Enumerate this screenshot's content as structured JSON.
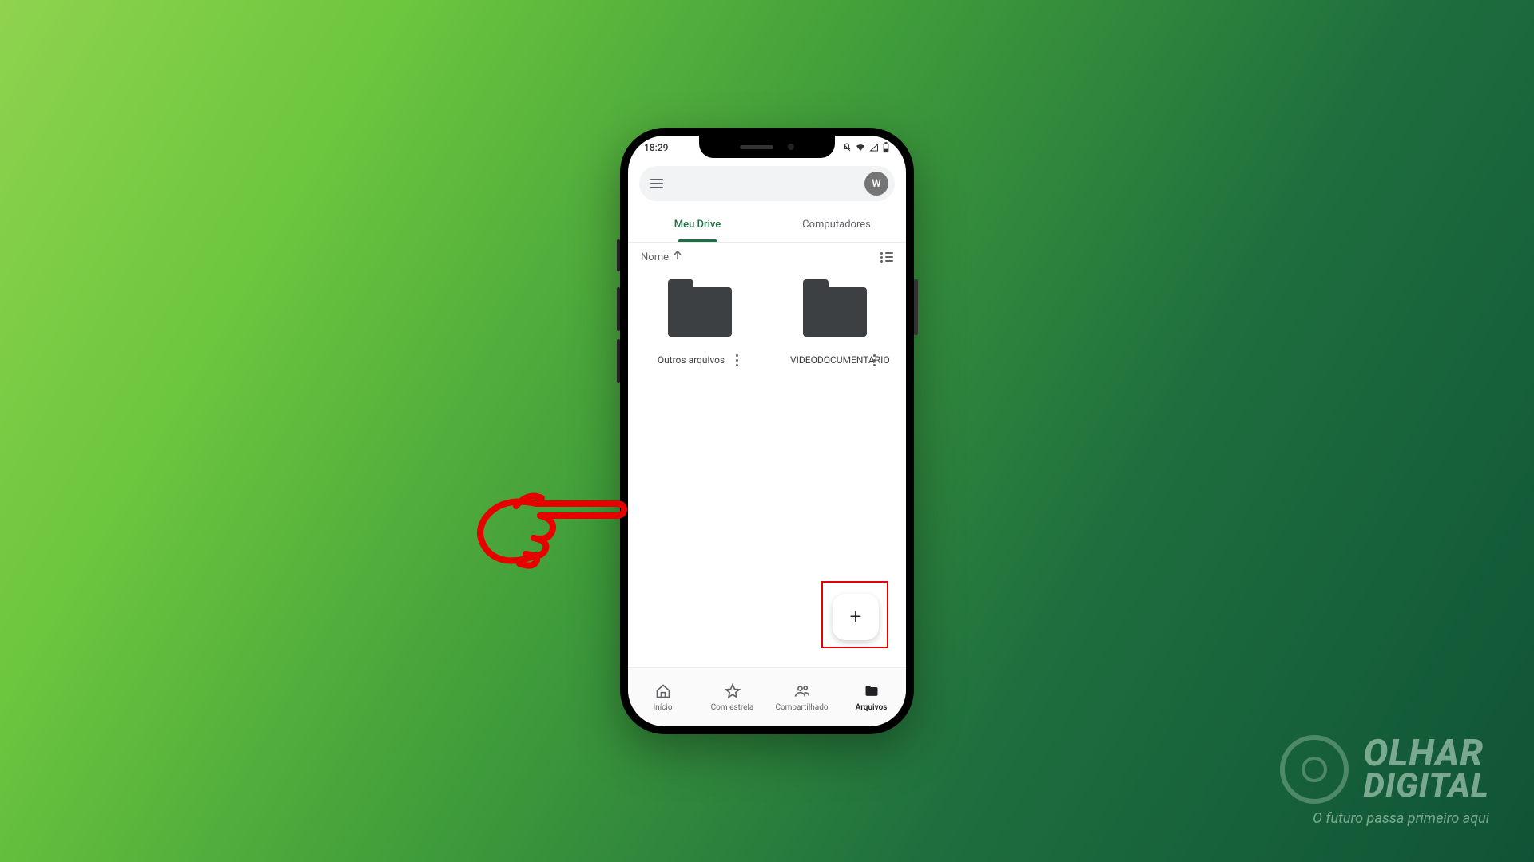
{
  "statusbar": {
    "time": "18:29"
  },
  "search": {
    "avatar_initial": "W"
  },
  "tabs": {
    "mydrive": "Meu Drive",
    "computers": "Computadores"
  },
  "sort": {
    "label": "Nome"
  },
  "folders": [
    {
      "name": "Outros arquivos"
    },
    {
      "name": "VIDEODOCUMENTARIO"
    }
  ],
  "fab": {
    "symbol": "+"
  },
  "bottomnav": {
    "home": "Início",
    "starred": "Com estrela",
    "shared": "Compartilhado",
    "files": "Arquivos"
  },
  "watermark": {
    "line1": "OLHAR",
    "line2": "DIGITAL",
    "tagline": "O futuro passa primeiro aqui"
  }
}
